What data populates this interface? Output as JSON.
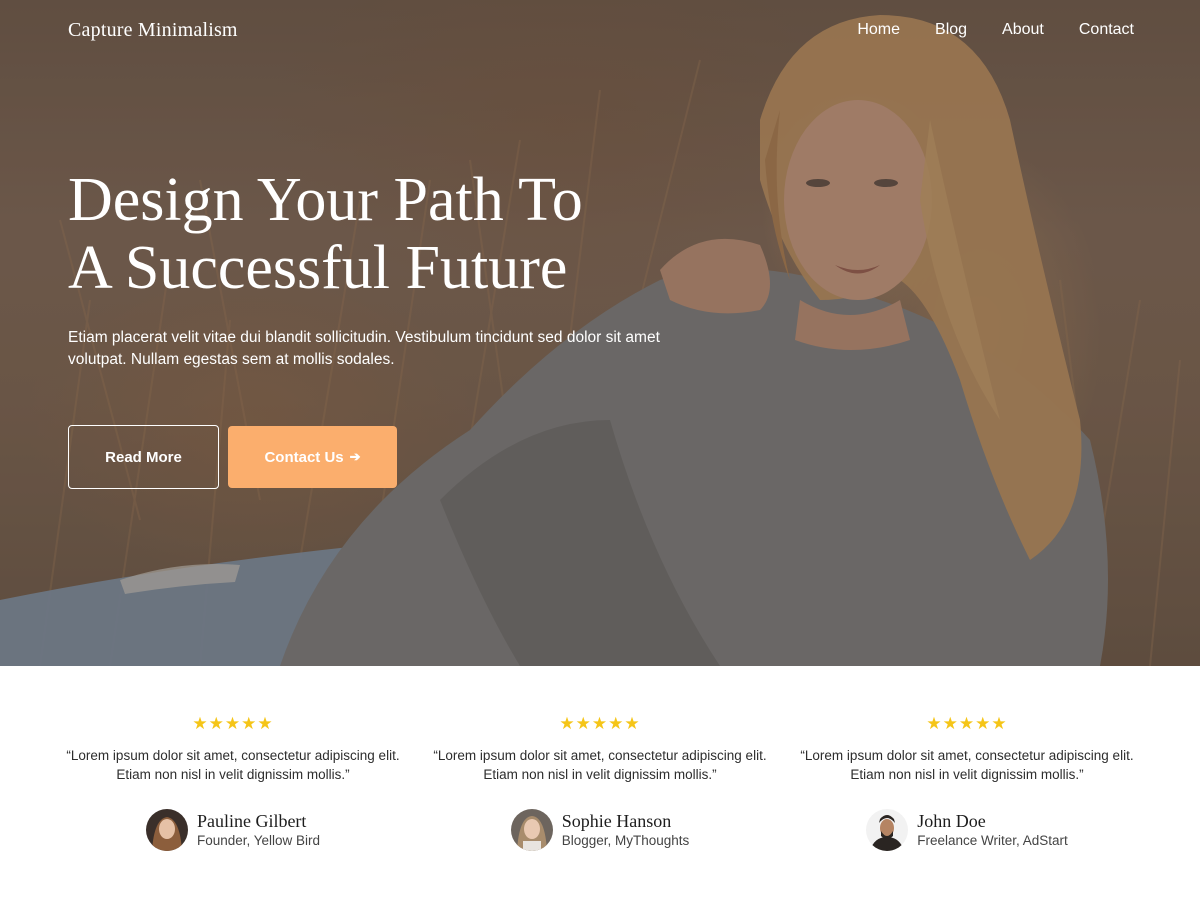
{
  "header": {
    "site_title": "Capture Minimalism",
    "nav": [
      {
        "label": "Home"
      },
      {
        "label": "Blog"
      },
      {
        "label": "About"
      },
      {
        "label": "Contact"
      }
    ]
  },
  "hero": {
    "title_line1": "Design Your Path To",
    "title_line2": "A Successful Future",
    "text": "Etiam placerat velit vitae dui blandit sollicitudin. Vestibulum tincidunt sed dolor sit amet volutpat. Nullam egestas sem at mollis sodales.",
    "read_more_label": "Read More",
    "contact_label": "Contact Us",
    "contact_arrow": "➔",
    "accent_color": "#fbae6d"
  },
  "testimonials": [
    {
      "rating": 5,
      "stars": "★★★★★",
      "quote": "“Lorem ipsum dolor sit amet, consectetur adipiscing elit. Etiam non nisl in velit dignissim mollis.”",
      "name": "Pauline Gilbert",
      "role": "Founder, Yellow Bird"
    },
    {
      "rating": 5,
      "stars": "★★★★★",
      "quote": "“Lorem ipsum dolor sit amet, consectetur adipiscing elit. Etiam non nisl in velit dignissim mollis.”",
      "name": "Sophie Hanson",
      "role": "Blogger, MyThoughts"
    },
    {
      "rating": 5,
      "stars": "★★★★★",
      "quote": "“Lorem ipsum dolor sit amet, consectetur adipiscing elit. Etiam non nisl in velit dignissim mollis.”",
      "name": "John Doe",
      "role": "Freelance Writer, AdStart"
    }
  ],
  "colors": {
    "star": "#f5c518",
    "button_accent": "#fbae6d"
  }
}
